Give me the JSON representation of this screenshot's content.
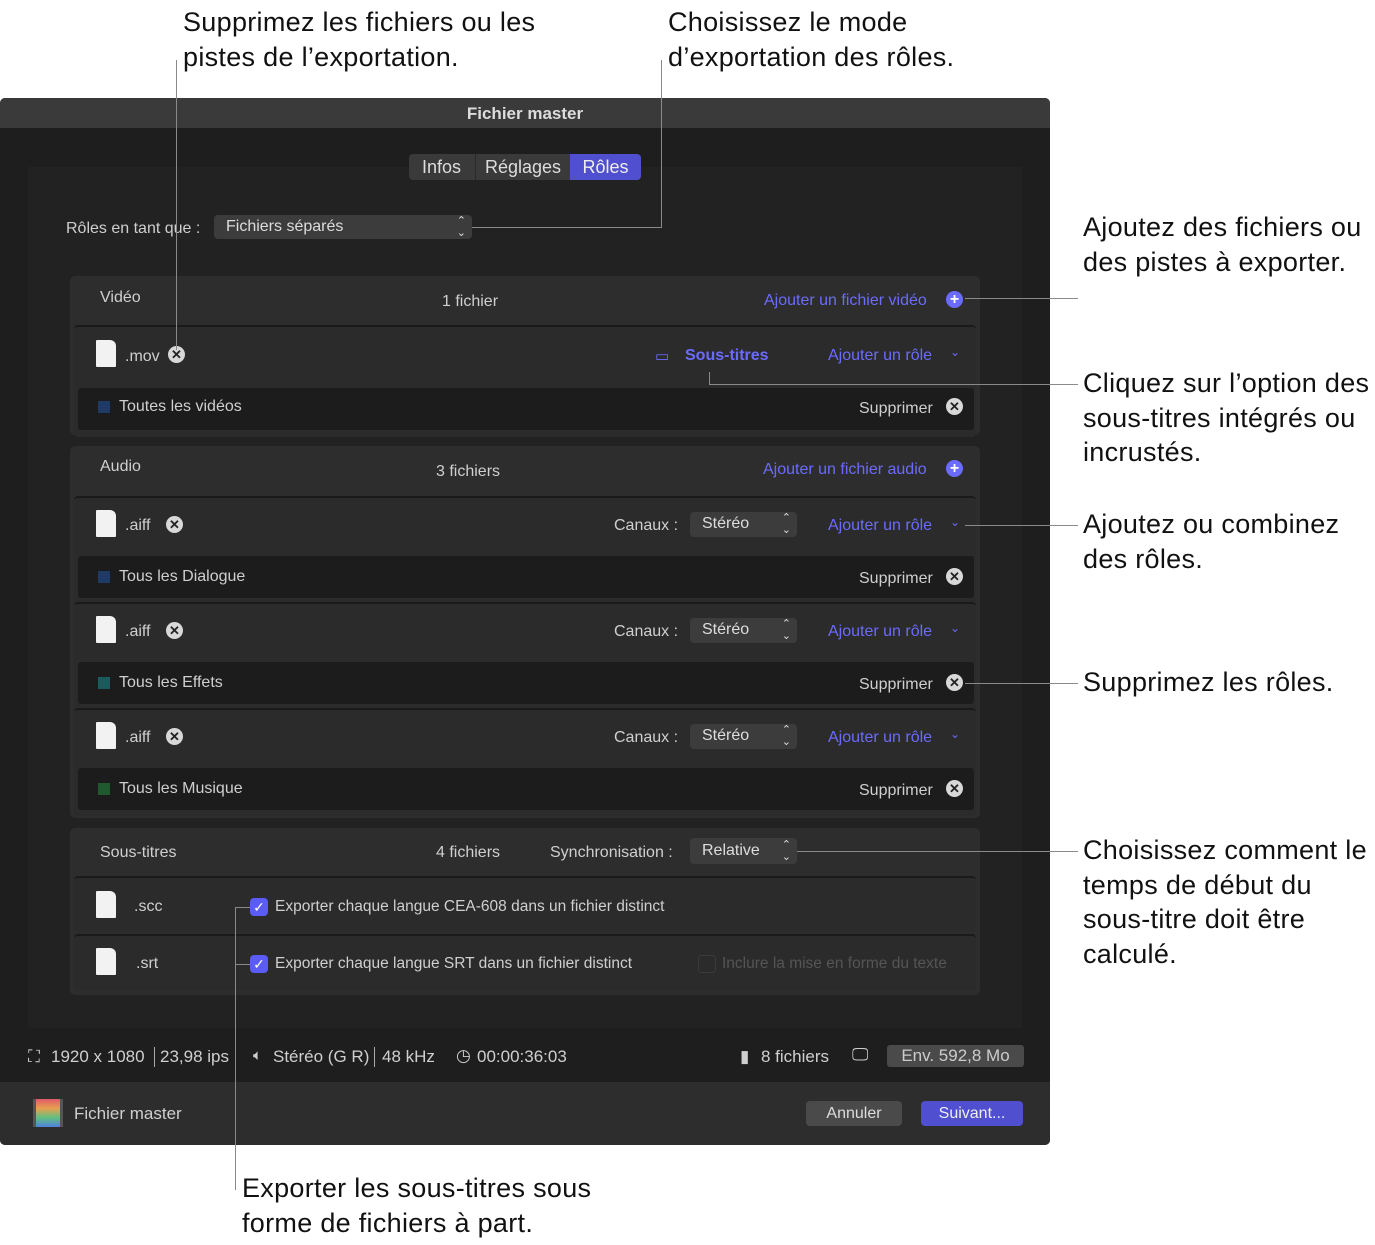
{
  "annotations": {
    "remove_files": "Supprimez les fichiers ou les pistes de l’exportation.",
    "roles_mode": "Choisissez le mode d’exportation des rôles.",
    "add_files": "Ajoutez des fichiers ou des pistes à exporter.",
    "subtitles_option": "Cliquez sur l’option des sous-titres intégrés ou incrustés.",
    "add_roles": "Ajoutez ou combinez des rôles.",
    "remove_roles": "Supprimez les rôles.",
    "sync": "Choisissez comment le temps de début du sous-titre doit être calculé.",
    "export_subs": "Exporter les sous-titres sous forme de fichiers à part."
  },
  "window": {
    "title": "Fichier master"
  },
  "tabs": [
    {
      "label": "Infos"
    },
    {
      "label": "Réglages"
    },
    {
      "label": "Rôles",
      "active": true
    }
  ],
  "roles_as": {
    "label": "Rôles en tant que :",
    "value": "Fichiers séparés"
  },
  "video": {
    "title": "Vidéo",
    "count": "1 fichier",
    "add": "Ajouter un fichier vidéo",
    "file": {
      "ext": ".mov",
      "subtitles": "Sous-titres",
      "add_role": "Ajouter un rôle",
      "role": "Toutes les vidéos",
      "role_color": "#1f3a66",
      "remove": "Supprimer"
    }
  },
  "audio": {
    "title": "Audio",
    "count": "3 fichiers",
    "add": "Ajouter un fichier audio",
    "channels_label": "Canaux :",
    "files": [
      {
        "ext": ".aiff",
        "channels": "Stéréo",
        "add_role": "Ajouter un rôle",
        "role": "Tous les Dialogue",
        "role_color": "#1f3a66",
        "remove": "Supprimer"
      },
      {
        "ext": ".aiff",
        "channels": "Stéréo",
        "add_role": "Ajouter un rôle",
        "role": "Tous les Effets",
        "role_color": "#1d5a5e",
        "remove": "Supprimer"
      },
      {
        "ext": ".aiff",
        "channels": "Stéréo",
        "add_role": "Ajouter un rôle",
        "role": "Tous les Musique",
        "role_color": "#1f5a2e",
        "remove": "Supprimer"
      }
    ]
  },
  "subtitles": {
    "title": "Sous-titres",
    "count": "4 fichiers",
    "sync_label": "Synchronisation :",
    "sync_value": "Relative",
    "files": [
      {
        "ext": ".scc",
        "option": "Exporter chaque langue CEA-608 dans un fichier distinct",
        "checked": true
      },
      {
        "ext": ".srt",
        "option": "Exporter chaque langue SRT dans un fichier distinct",
        "checked": true,
        "extra": "Inclure la mise en forme du texte",
        "extra_checked": false
      }
    ]
  },
  "status": {
    "resolution": "1920 x 1080",
    "fps": "23,98 ips",
    "audio": "Stéréo (G R)",
    "rate": "48 kHz",
    "duration": "00:00:36:03",
    "files": "8 fichiers",
    "size": "Env. 592,8 Mo"
  },
  "footer": {
    "name": "Fichier master",
    "cancel": "Annuler",
    "next": "Suivant..."
  },
  "colors": {
    "accent": "#5b5bf5",
    "background": "#1e1e1e"
  }
}
